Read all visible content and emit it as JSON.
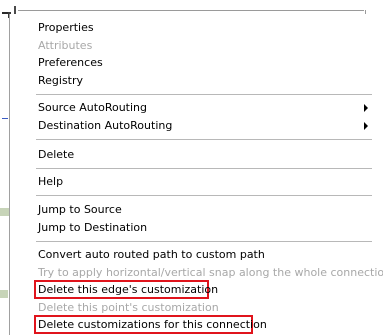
{
  "context_menu": {
    "items": [
      {
        "label": "Properties",
        "enabled": true
      },
      {
        "label": "Attributes",
        "enabled": false
      },
      {
        "label": "Preferences",
        "enabled": true
      },
      {
        "label": "Registry",
        "enabled": true
      },
      {
        "label": "Source AutoRouting",
        "enabled": true,
        "submenu": true
      },
      {
        "label": "Destination AutoRouting",
        "enabled": true,
        "submenu": true
      },
      {
        "label": "Delete",
        "enabled": true
      },
      {
        "label": "Help",
        "enabled": true
      },
      {
        "label": "Jump to Source",
        "enabled": true
      },
      {
        "label": "Jump to Destination",
        "enabled": true
      },
      {
        "label": "Convert auto routed path to custom path",
        "enabled": true
      },
      {
        "label": "Try to apply horizontal/vertical snap along the whole connection",
        "enabled": false
      },
      {
        "label": "Delete this edge's customization",
        "enabled": true,
        "highlighted": true
      },
      {
        "label": "Delete this point's customization",
        "enabled": false
      },
      {
        "label": "Delete customizations for this connection",
        "enabled": true,
        "highlighted": true
      }
    ]
  },
  "colors": {
    "highlight_border": "#e0141c",
    "disabled_text": "#a8a8a8",
    "separator": "#b8b8b8"
  },
  "icons": [
    "submenu-arrow-icon"
  ]
}
